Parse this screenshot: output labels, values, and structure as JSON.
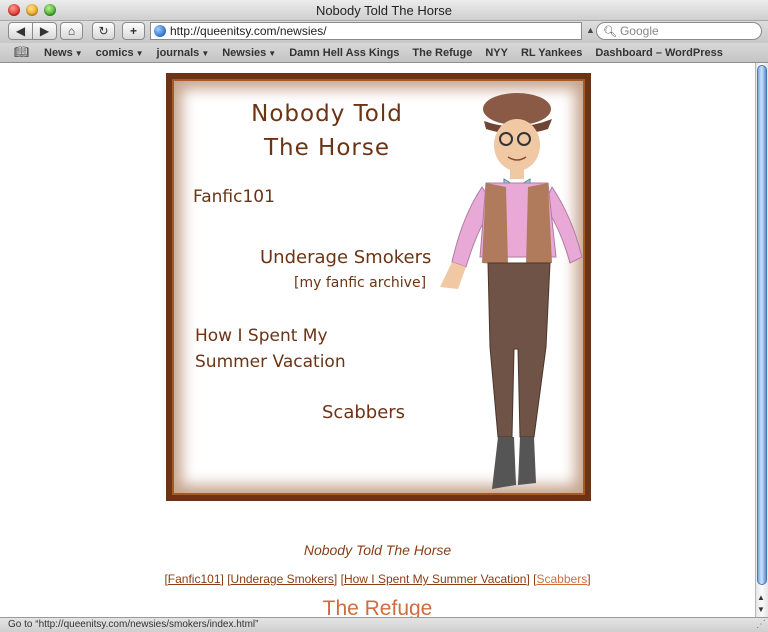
{
  "window": {
    "title": "Nobody Told The Horse",
    "colors": {
      "close": "#e0302a",
      "minimize": "#e6a21c",
      "zoom": "#3fa82a"
    }
  },
  "toolbar": {
    "back_icon": "◀",
    "forward_icon": "▶",
    "home_icon": "⌂",
    "reload_icon": "↻",
    "add_icon": "+",
    "address": "http://queenitsy.com/newsies/",
    "search_placeholder": "Google",
    "search_icon": "🔍︎",
    "snapback_icon": "▲"
  },
  "bookmarks": {
    "book_icon": "📖︎",
    "items": [
      {
        "label": "News",
        "menu": true
      },
      {
        "label": "comics",
        "menu": true
      },
      {
        "label": "journals",
        "menu": true
      },
      {
        "label": "Newsies",
        "menu": true
      },
      {
        "label": "Damn Hell Ass Kings",
        "menu": false
      },
      {
        "label": "The Refuge",
        "menu": false
      },
      {
        "label": "NYY",
        "menu": false
      },
      {
        "label": "RL Yankees",
        "menu": false
      },
      {
        "label": "Dashboard – WordPress",
        "menu": false
      }
    ],
    "menu_arrow": "▼"
  },
  "banner": {
    "title_line1": "Nobody Told",
    "title_line2": "The Horse",
    "link_fanfic": "Fanfic101",
    "link_smokers": "Underage Smokers",
    "link_archive": "[my fanfic archive]",
    "link_vacation_line1": "How I Spent My",
    "link_vacation_line2": "Summer Vacation",
    "link_scabbers": "Scabbers",
    "colors": {
      "frame": "#6b3415",
      "text": "#6b3415"
    }
  },
  "content": {
    "title": "Nobody Told The Horse",
    "nav": [
      {
        "label": "Fanfic101",
        "visited": false
      },
      {
        "label": "Underage Smokers",
        "visited": false
      },
      {
        "label": "How I Spent My Summer Vacation",
        "visited": false
      },
      {
        "label": "Scabbers",
        "visited": true
      }
    ],
    "refuge_heading": "The Refuge",
    "colors": {
      "link": "#8a3d14",
      "visited": "#cf6d3f"
    }
  },
  "scrollbar": {
    "up_icon": "▲",
    "down_icon": "▼"
  },
  "status": {
    "text": "Go to “http://queenitsy.com/newsies/smokers/index.html”"
  }
}
